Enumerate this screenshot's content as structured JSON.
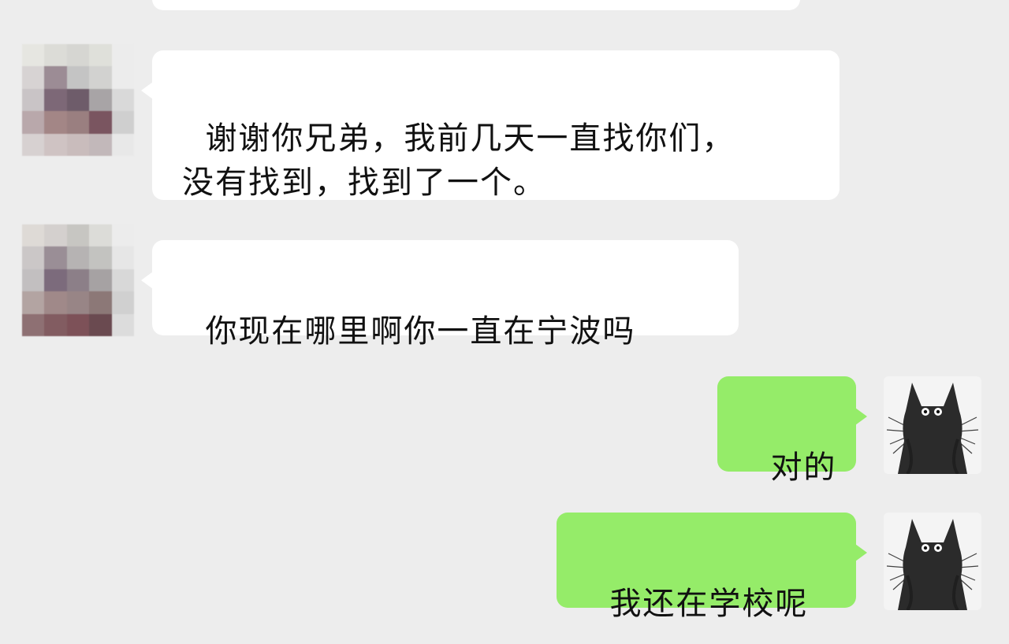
{
  "chat": {
    "messages": [
      {
        "side": "received",
        "text": "谢谢你兄弟，我前几天一直找你们，\n没有找到，找到了一个。"
      },
      {
        "side": "received",
        "text": "你现在哪里啊你一直在宁波吗"
      },
      {
        "side": "sent",
        "text": "对的"
      },
      {
        "side": "sent",
        "text": "我还在学校呢"
      }
    ]
  },
  "avatars": {
    "contact": {
      "icon": "pixelated-avatar-icon"
    },
    "self": {
      "icon": "black-cat-avatar-icon"
    }
  },
  "colors": {
    "background": "#ededed",
    "received_bubble": "#ffffff",
    "sent_bubble": "#95ec69",
    "text": "#111111"
  }
}
